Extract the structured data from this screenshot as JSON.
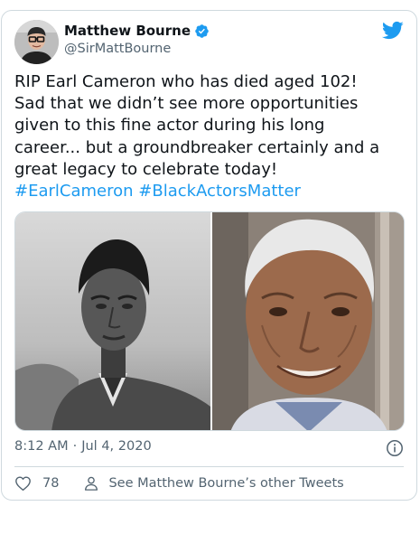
{
  "author": {
    "display_name": "Matthew Bourne",
    "handle": "@SirMattBourne",
    "verified": true
  },
  "tweet": {
    "lines": [
      "RIP Earl Cameron who has died aged 102!",
      "Sad that we didn’t see more opportunities",
      "given to this fine actor during his long",
      "career... but a groundbreaker certainly and a",
      "great legacy to celebrate today!"
    ],
    "hashtags": [
      "#EarlCameron",
      "#BlackActorsMatter"
    ]
  },
  "media": {
    "count": 2
  },
  "meta": {
    "time": "8:12 AM",
    "separator": "·",
    "date": "Jul 4, 2020"
  },
  "actions": {
    "like_count": "78",
    "profile_link": "See Matthew Bourne’s other Tweets"
  },
  "colors": {
    "brand": "#1d9bf0",
    "text": "#0f1419",
    "secondary": "#536471",
    "border": "#cfd9de"
  },
  "icons": {
    "brand": "twitter-bird-icon",
    "verified": "verified-badge-icon",
    "info": "info-icon",
    "like": "heart-icon",
    "profile": "person-icon"
  }
}
